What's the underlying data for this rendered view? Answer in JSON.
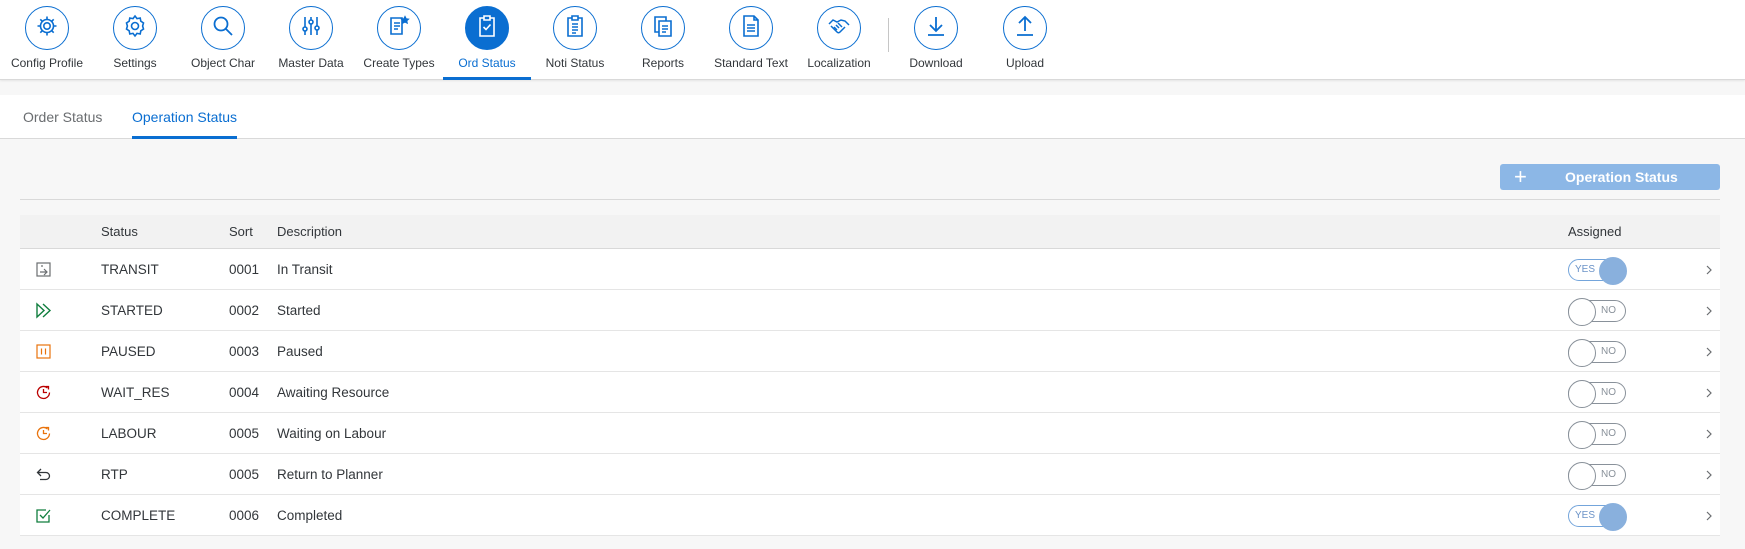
{
  "toolbar": {
    "items": [
      {
        "label": "Config Profile",
        "icon": "config-profile-icon"
      },
      {
        "label": "Settings",
        "icon": "settings-icon"
      },
      {
        "label": "Object Char",
        "icon": "search-icon"
      },
      {
        "label": "Master Data",
        "icon": "sliders-icon"
      },
      {
        "label": "Create Types",
        "icon": "create-types-icon"
      },
      {
        "label": "Ord Status",
        "icon": "clipboard-check-icon",
        "active": true
      },
      {
        "label": "Noti Status",
        "icon": "clipboard-list-icon"
      },
      {
        "label": "Reports",
        "icon": "reports-icon"
      },
      {
        "label": "Standard Text",
        "icon": "document-icon"
      },
      {
        "label": "Localization",
        "icon": "handshake-icon"
      },
      {
        "label": "Download",
        "icon": "download-icon"
      },
      {
        "label": "Upload",
        "icon": "upload-icon"
      }
    ],
    "accent": "#0a6ed1"
  },
  "tabs": [
    {
      "label": "Order Status",
      "active": false
    },
    {
      "label": "Operation Status",
      "active": true
    }
  ],
  "add_button": {
    "icon": "plus-icon",
    "label": "Operation Status"
  },
  "table": {
    "headers": {
      "status": "Status",
      "sort": "Sort",
      "description": "Description",
      "assigned": "Assigned"
    },
    "rows": [
      {
        "icon": "transit-icon",
        "icon_color": "#6a6d70",
        "status": "TRANSIT",
        "sort": "0001",
        "description": "In Transit",
        "assigned": true,
        "switch_text": "YES"
      },
      {
        "icon": "started-icon",
        "icon_color": "#107e3e",
        "status": "STARTED",
        "sort": "0002",
        "description": "Started",
        "assigned": false,
        "switch_text": "NO"
      },
      {
        "icon": "paused-icon",
        "icon_color": "#e9730c",
        "status": "PAUSED",
        "sort": "0003",
        "description": "Paused",
        "assigned": false,
        "switch_text": "NO"
      },
      {
        "icon": "pending-icon",
        "icon_color": "#bb0000",
        "status": "WAIT_RES",
        "sort": "0004",
        "description": "Awaiting Resource",
        "assigned": false,
        "switch_text": "NO"
      },
      {
        "icon": "pending-icon",
        "icon_color": "#e9730c",
        "status": "LABOUR",
        "sort": "0005",
        "description": "Waiting on Labour",
        "assigned": false,
        "switch_text": "NO"
      },
      {
        "icon": "return-icon",
        "icon_color": "#32363a",
        "status": "RTP",
        "sort": "0005",
        "description": "Return to Planner",
        "assigned": false,
        "switch_text": "NO"
      },
      {
        "icon": "complete-icon",
        "icon_color": "#107e3e",
        "status": "COMPLETE",
        "sort": "0006",
        "description": "Completed",
        "assigned": true,
        "switch_text": "YES"
      }
    ]
  }
}
